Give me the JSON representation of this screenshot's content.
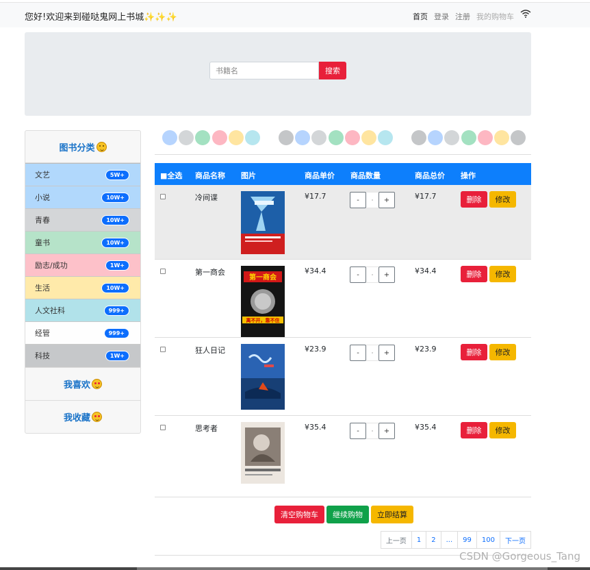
{
  "navbar": {
    "brand": "您好!欢迎来到碰哒鬼网上书城",
    "links": {
      "home": "首页",
      "login": "登录",
      "register": "注册",
      "cart": "我的购物车"
    }
  },
  "search": {
    "placeholder": "书籍名",
    "button": "搜索"
  },
  "sidebar": {
    "heading": "图书分类",
    "categories": [
      {
        "name": "文艺",
        "count": "5W+",
        "color": "#b1d8fc"
      },
      {
        "name": "小说",
        "count": "10W+",
        "color": "#b1d8fc"
      },
      {
        "name": "青春",
        "count": "10W+",
        "color": "#d4d6d8"
      },
      {
        "name": "童书",
        "count": "10W+",
        "color": "#b6e3c9"
      },
      {
        "name": "励志/成功",
        "count": "1W+",
        "color": "#fdc1c9"
      },
      {
        "name": "生活",
        "count": "10W+",
        "color": "#ffeaaa"
      },
      {
        "name": "人文社科",
        "count": "999+",
        "color": "#b1e2ea"
      },
      {
        "name": "经管",
        "count": "999+",
        "color": "#fefefe"
      },
      {
        "name": "科技",
        "count": "1W+",
        "color": "#c6c8ca"
      }
    ],
    "like": "我喜欢",
    "favorite": "我收藏"
  },
  "palette": [
    "#b6d4fe",
    "#d3d6d8",
    "#a3e1c1",
    "#fdb7c2",
    "#ffe5a0",
    "#b6e6ef",
    "#c4c6c8"
  ],
  "cart": {
    "headers": {
      "select_all": "■全选",
      "name": "商品名称",
      "image": "图片",
      "unit_price": "商品单价",
      "quantity": "商品数量",
      "total": "商品总价",
      "ops": "操作"
    },
    "qty_minus": "-",
    "qty_plus": "+",
    "qty_value": "·",
    "delete": "删除",
    "edit": "修改",
    "items": [
      {
        "name": "冷间谍",
        "price": "¥17.7",
        "total": "¥17.7",
        "cover": "spy"
      },
      {
        "name": "第一商会",
        "price": "¥34.4",
        "total": "¥34.4",
        "cover": "commerce"
      },
      {
        "name": "狂人日记",
        "price": "¥23.9",
        "total": "¥23.9",
        "cover": "diary"
      },
      {
        "name": "思考者",
        "price": "¥35.4",
        "total": "¥35.4",
        "cover": "thinker"
      }
    ],
    "cover_text": {
      "commerce_title": "第一商会",
      "commerce_sub": "离不开，靠不住"
    }
  },
  "actions": {
    "clear": "清空购物车",
    "continue": "继续购物",
    "checkout": "立即结算"
  },
  "pagination": [
    "上一页",
    "1",
    "2",
    "...",
    "99",
    "100",
    "下一页"
  ],
  "watermark": "CSDN @Gorgeous_Tang"
}
